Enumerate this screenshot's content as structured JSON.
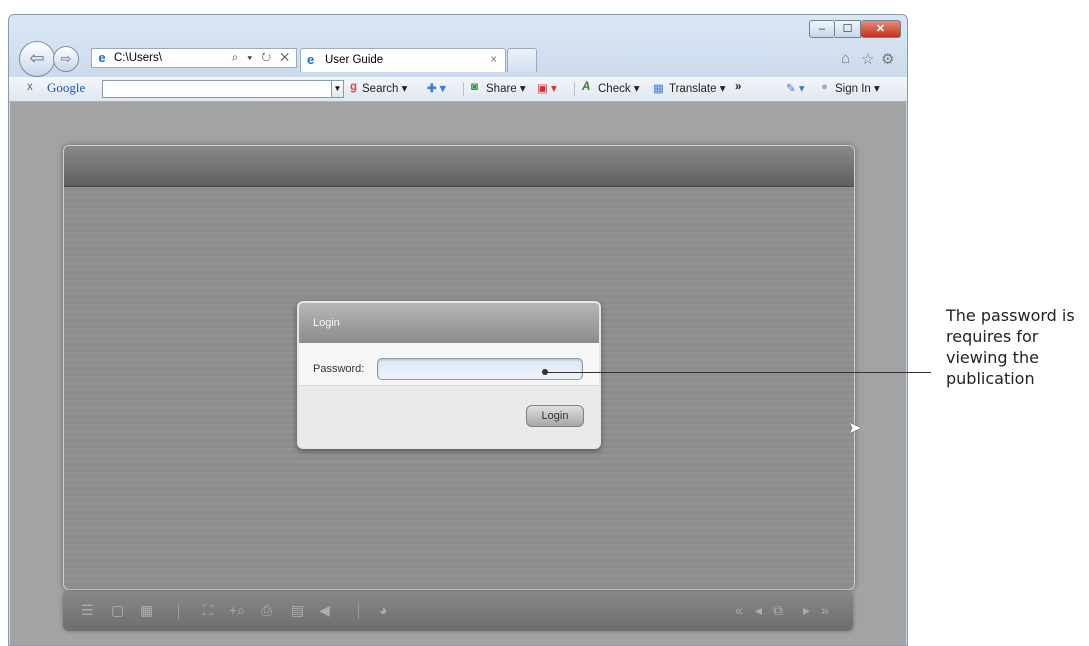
{
  "browser": {
    "address": "C:\\Users\\",
    "address_tools": "⌕ ▾ ↻ ✕",
    "tab_title": "User Guide",
    "tab_close": "×",
    "window_controls": {
      "minimize": "–",
      "maximize": "☐",
      "close": "✕"
    },
    "right_icons": [
      "home-icon",
      "star-icon",
      "gear-icon"
    ]
  },
  "google_toolbar": {
    "close": "x",
    "brand": "Google",
    "search_value": "",
    "search_label": "Search ▾",
    "share_label": "Share ▾",
    "check_label": "Check ▾",
    "translate_label": "Translate ▾",
    "more": "»",
    "signin_label": "Sign In ▾"
  },
  "login_dialog": {
    "title": "Login",
    "password_label": "Password:",
    "password_value": "",
    "login_button": "Login"
  },
  "annotation": {
    "text": "The password is requires for viewing the publication"
  },
  "colors": {
    "viewer_background": "#8e8e8e",
    "dialog_background": "#eaeaea",
    "input_background": "#dde8f4"
  }
}
